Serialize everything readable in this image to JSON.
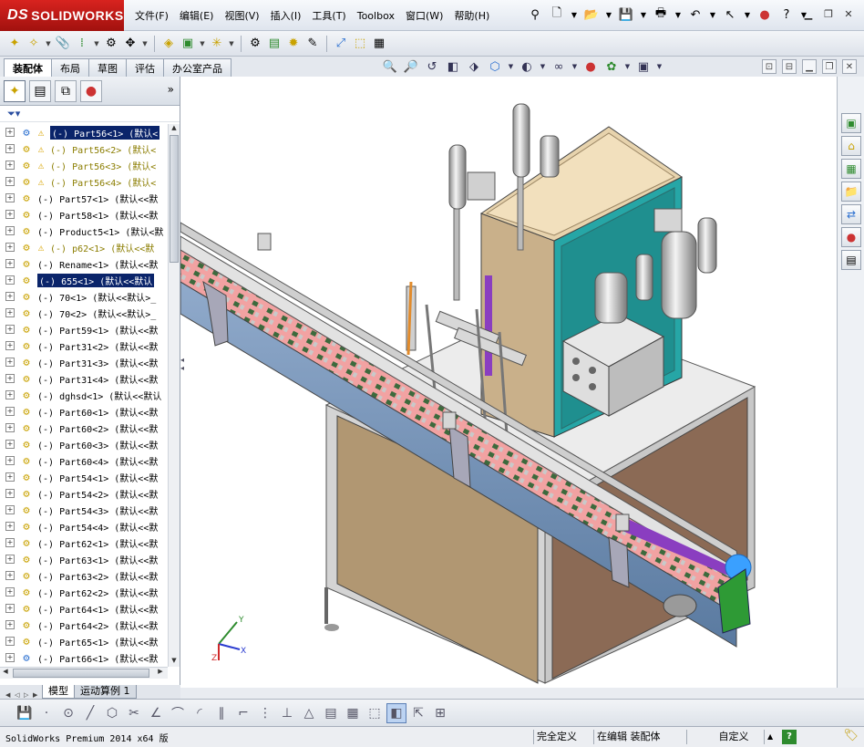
{
  "app": {
    "brand": "SOLIDWORKS",
    "brand_ds": "DS"
  },
  "menu": [
    "文件(F)",
    "编辑(E)",
    "视图(V)",
    "插入(I)",
    "工具(T)",
    "Toolbox",
    "窗口(W)",
    "帮助(H)"
  ],
  "tabs": [
    "装配体",
    "布局",
    "草图",
    "评估",
    "办公室产品"
  ],
  "filter_icon": "funnel-icon",
  "more_label": "»",
  "tree": [
    {
      "label": "(-) Part56<1> (默认<",
      "warn": true,
      "sel": true
    },
    {
      "label": "(-) Part56<2> (默认<",
      "warn": true,
      "light": true
    },
    {
      "label": "(-) Part56<3> (默认<",
      "warn": true,
      "light": true
    },
    {
      "label": "(-) Part56<4> (默认<",
      "warn": true,
      "light": true
    },
    {
      "label": "(-) Part57<1> (默认<<默"
    },
    {
      "label": "(-) Part58<1> (默认<<默"
    },
    {
      "label": "(-) Product5<1> (默认<默"
    },
    {
      "label": "(-) p62<1> (默认<<默",
      "warn": true,
      "light": true
    },
    {
      "label": "(-) Rename<1> (默认<<默"
    },
    {
      "label": "(-) 655<1> (默认<<默认",
      "sel": true
    },
    {
      "label": "(-) 70<1> (默认<<默认>_"
    },
    {
      "label": "(-) 70<2> (默认<<默认>_"
    },
    {
      "label": "(-) Part59<1> (默认<<默"
    },
    {
      "label": "(-) Part31<2> (默认<<默"
    },
    {
      "label": "(-) Part31<3> (默认<<默"
    },
    {
      "label": "(-) Part31<4> (默认<<默"
    },
    {
      "label": "(-) dghsd<1> (默认<<默认"
    },
    {
      "label": "(-) Part60<1> (默认<<默"
    },
    {
      "label": "(-) Part60<2> (默认<<默"
    },
    {
      "label": "(-) Part60<3> (默认<<默"
    },
    {
      "label": "(-) Part60<4> (默认<<默"
    },
    {
      "label": "(-) Part54<1> (默认<<默"
    },
    {
      "label": "(-) Part54<2> (默认<<默"
    },
    {
      "label": "(-) Part54<3> (默认<<默"
    },
    {
      "label": "(-) Part54<4> (默认<<默"
    },
    {
      "label": "(-) Part62<1> (默认<<默"
    },
    {
      "label": "(-) Part63<1> (默认<<默"
    },
    {
      "label": "(-) Part63<2> (默认<<默"
    },
    {
      "label": "(-) Part62<2> (默认<<默"
    },
    {
      "label": "(-) Part64<1> (默认<<默"
    },
    {
      "label": "(-) Part64<2> (默认<<默"
    },
    {
      "label": "(-) Part65<1> (默认<<默"
    },
    {
      "label": "(-) Part66<1> (默认<<默"
    }
  ],
  "model_tabs": [
    "模型",
    "运动算例 1"
  ],
  "status": {
    "product": "SolidWorks Premium 2014 x64 版",
    "constraint": "完全定义",
    "editing": "在编辑 装配体",
    "units": "自定义",
    "help": "?"
  },
  "triad": {
    "x": "X",
    "y": "Y",
    "z": "Z"
  },
  "colors": {
    "brand_red": "#c4201c",
    "selection": "#0a246a",
    "cabinet_side": "#26a6a6",
    "panel_tan": "#d8c3a0",
    "chain": "#f2a2a2",
    "conveyor_blue": "#6e8fb3",
    "purple_rod": "#8a3ec0",
    "orange_rod": "#e18b2c"
  }
}
